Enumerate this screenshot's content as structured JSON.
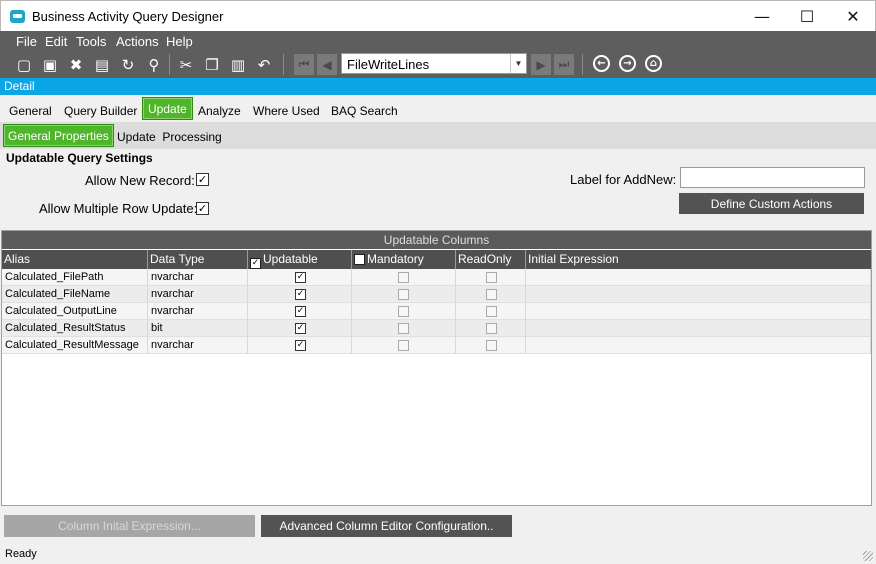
{
  "window": {
    "title": "Business Activity Query Designer",
    "minimize_glyph": "—",
    "maximize_glyph": "☐",
    "close_glyph": "✕"
  },
  "menu": {
    "file": "File",
    "edit": "Edit",
    "tools": "Tools",
    "actions": "Actions",
    "help": "Help"
  },
  "toolbar": {
    "icons": [
      "new-icon",
      "save-icon",
      "delete-icon",
      "clear-icon",
      "refresh-icon",
      "broom-icon",
      "cut-icon",
      "copy-icon",
      "paste-icon",
      "undo-icon",
      "first-record-icon",
      "previous-record-icon",
      "next-record-icon",
      "last-record-icon",
      "back-icon",
      "forward-icon",
      "home-icon"
    ],
    "record_selector": "FileWriteLines"
  },
  "detail_bar": {
    "label": "Detail"
  },
  "tabs": {
    "general": "General",
    "query_builder": "Query Builder",
    "update": "Update",
    "analyze": "Analyze",
    "where_used": "Where Used",
    "baq_search": "BAQ Search",
    "active": "Update"
  },
  "subtabs": {
    "general_properties": "General Properties",
    "update_processing": "Update  Processing",
    "active": "General Properties"
  },
  "settings": {
    "title": "Updatable Query Settings",
    "allow_new_record_label": "Allow New Record:",
    "allow_new_record": true,
    "allow_multiple_row_update_label": "Allow Multiple Row Update:",
    "allow_multiple_row_update": true,
    "label_for_addnew_label": "Label for AddNew:",
    "label_for_addnew_value": "",
    "define_custom_actions": "Define Custom Actions"
  },
  "grid": {
    "caption": "Updatable Columns",
    "columns": {
      "alias": "Alias",
      "data_type": "Data Type",
      "updatable": "Updatable",
      "mandatory": "Mandatory",
      "readonly": "ReadOnly",
      "initial_expression": "Initial Expression"
    },
    "header_updatable_checked": true,
    "header_mandatory_checked": false,
    "rows": [
      {
        "alias": "Calculated_FilePath",
        "data_type": "nvarchar",
        "updatable": true,
        "mandatory": false,
        "readonly": false,
        "initial_expression": ""
      },
      {
        "alias": "Calculated_FileName",
        "data_type": "nvarchar",
        "updatable": true,
        "mandatory": false,
        "readonly": false,
        "initial_expression": ""
      },
      {
        "alias": "Calculated_OutputLine",
        "data_type": "nvarchar",
        "updatable": true,
        "mandatory": false,
        "readonly": false,
        "initial_expression": ""
      },
      {
        "alias": "Calculated_ResultStatus",
        "data_type": "bit",
        "updatable": true,
        "mandatory": false,
        "readonly": false,
        "initial_expression": ""
      },
      {
        "alias": "Calculated_ResultMessage",
        "data_type": "nvarchar",
        "updatable": true,
        "mandatory": false,
        "readonly": false,
        "initial_expression": ""
      }
    ]
  },
  "buttons": {
    "column_initial_expression": "Column Inital Expression...",
    "advanced_column_editor": "Advanced Column Editor Configuration.."
  },
  "status": {
    "text": "Ready"
  },
  "colors": {
    "accent_blue": "#0aa6e6",
    "active_tab_green": "#4fb52b",
    "toolbar_gray": "#5e5e5e"
  }
}
